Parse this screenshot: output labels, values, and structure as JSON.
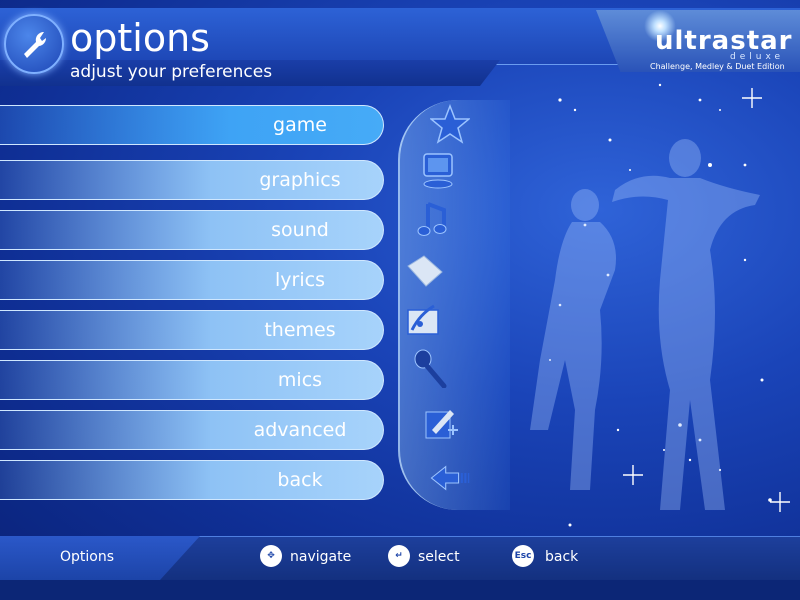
{
  "header": {
    "title": "options",
    "subtitle": "adjust your preferences"
  },
  "logo": {
    "main": "ultrastar",
    "deluxe": "deluxe",
    "edition": "Challenge, Medley & Duet Edition"
  },
  "menu": [
    {
      "label": "game",
      "icon": "star-icon",
      "active": true
    },
    {
      "label": "graphics",
      "icon": "monitor-icon"
    },
    {
      "label": "sound",
      "icon": "music-note-icon"
    },
    {
      "label": "lyrics",
      "icon": "paper-icon"
    },
    {
      "label": "themes",
      "icon": "paint-palette-icon"
    },
    {
      "label": "mics",
      "icon": "microphone-icon"
    },
    {
      "label": "advanced",
      "icon": "edit-icon"
    },
    {
      "label": "back",
      "icon": "back-arrow-icon"
    }
  ],
  "footer": {
    "section": "Options",
    "navigate_label": "navigate",
    "select_label": "select",
    "back_label": "back",
    "back_key": "Esc"
  },
  "colors": {
    "accent": "#3ea3f5",
    "button": "#8ec2f5",
    "background": "#1a44b8"
  }
}
